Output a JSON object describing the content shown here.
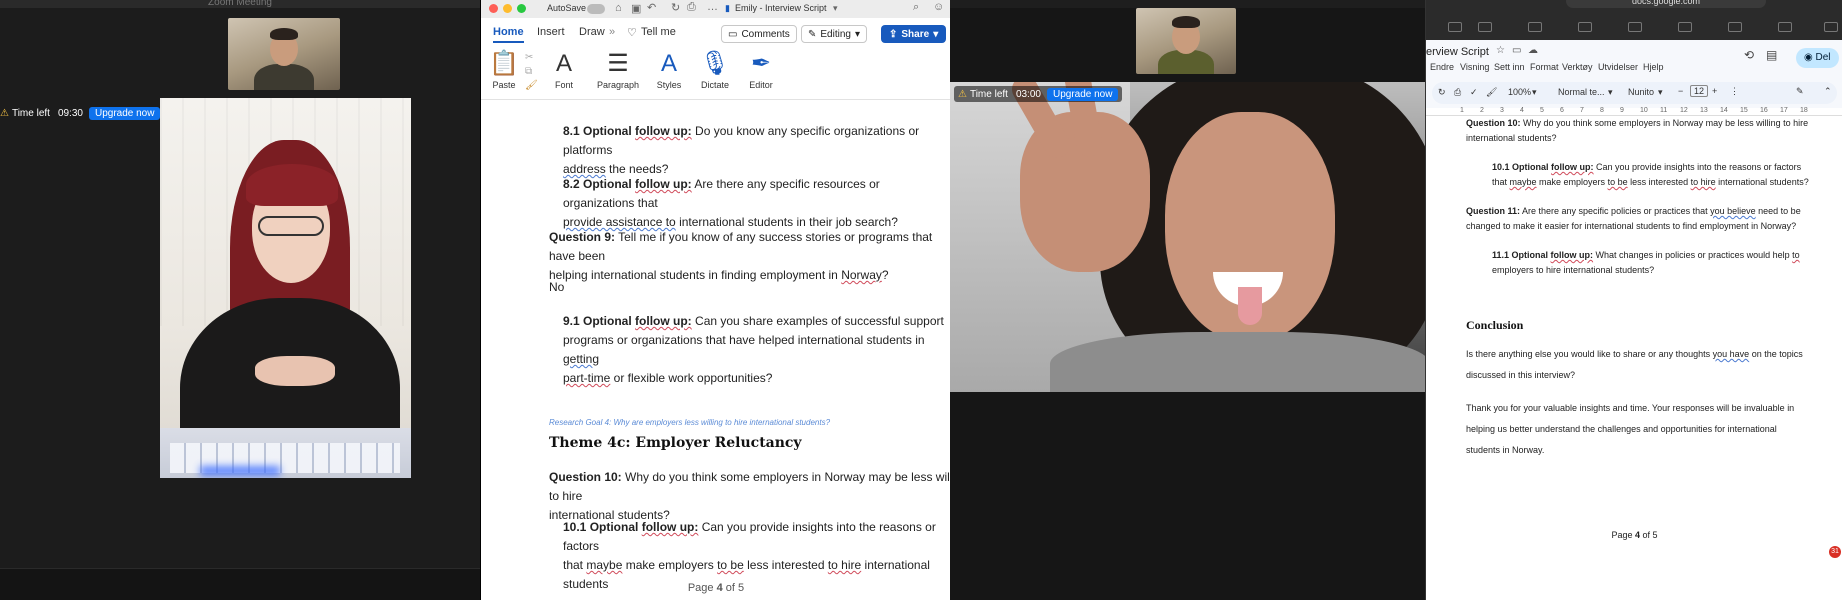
{
  "zoom_left": {
    "window_title": "Zoom Meeting",
    "timer_label": "Time left",
    "timer_value": "09:30",
    "upgrade_label": "Upgrade now"
  },
  "word": {
    "autosave_label": "AutoSave",
    "doc_title": "Emily - Interview Script",
    "tabs": [
      "Home",
      "Insert",
      "Draw",
      "Tell me"
    ],
    "comments_label": "Comments",
    "editing_label": "Editing",
    "share_label": "Share",
    "ribbon": [
      "Paste",
      "Font",
      "Paragraph",
      "Styles",
      "Dictate",
      "Editor"
    ],
    "content": {
      "q81_label": "8.1 Optional",
      "q81_followup": "follow up:",
      "q81_text1": " Do you know any specific organizations or platforms",
      "q81_text2": "address",
      "q81_text3": " the needs?",
      "q82_label": "8.2 Optional",
      "q82_followup": "follow up:",
      "q82_text1": " Are there any specific resources or organizations that",
      "q82_text2": "provide assistance to",
      "q82_text3": " international students in their job search?",
      "q9_label": "Question 9:",
      "q9_text1": " Tell me if you know of any success stories or programs that have been",
      "q9_text2": "helping international students in finding employment in ",
      "q9_norway": "Norway",
      "q9_end": "?",
      "answer_no": "No",
      "q91_label": "9.1 Optional",
      "q91_followup": "follow up:",
      "q91_text1": " Can you share examples of successful support",
      "q91_text2": "programs or organizations that have helped international students in ",
      "q91_getting": "getting",
      "q91_parttime": "part-time",
      "q91_text3": " or flexible work opportunities?",
      "research_goal": "Research Goal 4: Why are employers less willing to hire international students?",
      "theme": "Theme 4c: Employer Reluctancy",
      "q10_label": "Question 10:",
      "q10_text1": " Why do you think some employers in Norway may be less willing to hire",
      "q10_text2": "international students?",
      "q101_label": "10.1 Optional",
      "q101_followup": "follow up:",
      "q101_text1": " Can you provide insights into the reasons or factors",
      "q101_that": "that ",
      "q101_maybe": "maybe",
      "q101_make": " make employers ",
      "q101_tobe": "to be",
      "q101_less": " less interested ",
      "q101_tohire": "to hire",
      "q101_end": " international students"
    },
    "page_prefix": "Page ",
    "page_current": "4",
    "page_mid": " of ",
    "page_total": "5"
  },
  "zoom_right": {
    "timer_label": "Time left",
    "timer_value": "03:00",
    "upgrade_label": "Upgrade now"
  },
  "gdocs": {
    "url": "docs.google.com",
    "doc_title": "erview Script",
    "menu": [
      "Endre",
      "Visning",
      "Sett inn",
      "Format",
      "Verktøy",
      "Utvidelser",
      "Hjelp"
    ],
    "share_label": "Del",
    "zoom": "100%",
    "style": "Normal te...",
    "font": "Nunito",
    "font_size": "12",
    "ruler_marks": [
      "1",
      "2",
      "3",
      "4",
      "5",
      "6",
      "7",
      "8",
      "9",
      "10",
      "11",
      "12",
      "13",
      "14",
      "15",
      "16",
      "17",
      "18"
    ],
    "content": {
      "q10_label": "Question 10:",
      "q10_text": " Why do you think some employers in Norway may be less willing to hire",
      "q10_text2": "international students?",
      "q101_label": "10.1 Optional",
      "q101_followup": "follow up:",
      "q101_text": " Can you provide insights into the reasons or factors",
      "q101_that": "that ",
      "q101_maybe": "maybe",
      "q101_make": " make employers ",
      "q101_tobe": "to be",
      "q101_less": " less interested ",
      "q101_tohire": "to hire",
      "q101_end": " international students?",
      "q11_label": "Question 11:",
      "q11_text": " Are there any specific policies or practices that ",
      "q11_youbelieve": "you believe",
      "q11_text2": " need to be",
      "q11_text3": "changed to make it easier for international students to find employment in Norway?",
      "q111_label": "11.1 Optional",
      "q111_followup": "follow up:",
      "q111_text": " What changes in policies or practices would help ",
      "q111_to": "to",
      "q111_text2": "employers to hire international students?",
      "conclusion": "Conclusion",
      "c1": "Is there anything else you would like to share or any thoughts ",
      "c1_youhave": "you have",
      "c1_end": " on the topics",
      "c2": "discussed in this interview?",
      "t1": "Thank you for your valuable insights and time. Your responses will be invaluable in",
      "t2": "helping us better understand the challenges and opportunities for international",
      "t3": "students in Norway."
    },
    "page_prefix": "Page ",
    "page_current": "4",
    "page_mid": " of ",
    "page_total": "5",
    "badge": "31"
  }
}
